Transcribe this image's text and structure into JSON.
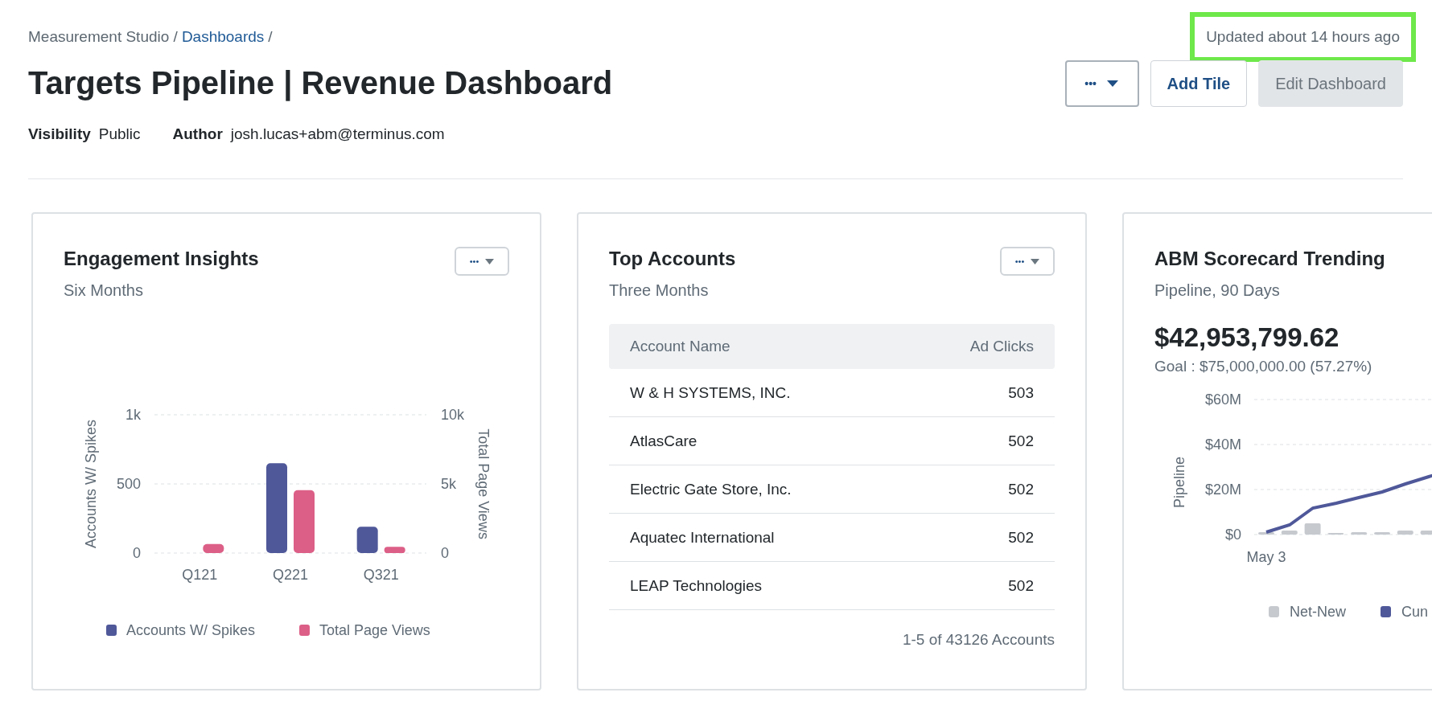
{
  "breadcrumb": {
    "root": "Measurement Studio",
    "separator": "/",
    "link": "Dashboards"
  },
  "updated": {
    "text": "Updated about 14 hours ago",
    "highlighted": true
  },
  "title": "Targets Pipeline | Revenue Dashboard",
  "actions": {
    "menu": "•••",
    "add": "Add Tile",
    "edit": "Edit Dashboard",
    "edit_disabled": true
  },
  "meta": [
    {
      "label": "Visibility",
      "value": "Public"
    },
    {
      "label": "Author",
      "value": "josh.lucas+abm@terminus.com"
    }
  ],
  "tiles": [
    {
      "kind": "bar",
      "title": "Engagement Insights",
      "subtitle": "Six Months",
      "menu": "•••",
      "chart_data": {
        "type": "bar",
        "stacked": false,
        "legend": true,
        "ylabel": "Accounts W/ Spikes",
        "y2label": "Total Page Views",
        "categories": [
          "Q121",
          "Q221",
          "Q321"
        ],
        "ylim": [
          0,
          1000
        ],
        "y2lim": [
          0,
          10000
        ],
        "yticks": [
          {
            "value": 0,
            "label": "0"
          },
          {
            "value": 500,
            "label": "500"
          },
          {
            "value": 1000,
            "label": "1k"
          }
        ],
        "y2ticks": [
          {
            "value": 0,
            "label": "0"
          },
          {
            "value": 5000,
            "label": "5k"
          },
          {
            "value": 10000,
            "label": "10k"
          }
        ],
        "series": [
          {
            "name": "Accounts W/ Spikes",
            "color": "#4f5899",
            "values": [
              0,
              650,
              190
            ]
          },
          {
            "name": "Total Page Views",
            "color": "#dc5f87",
            "axis": "y2",
            "values": [
              650,
              4550,
              450
            ]
          }
        ]
      }
    },
    {
      "kind": "table",
      "title": "Top Accounts",
      "subtitle": "Three Months",
      "menu": "•••",
      "columns": [
        "Account Name",
        "Ad Clicks"
      ],
      "rows": [
        [
          "W & H SYSTEMS, INC.",
          "503"
        ],
        [
          "AtlasCare",
          "502"
        ],
        [
          "Electric Gate Store, Inc.",
          "502"
        ],
        [
          "Aquatec International",
          "502"
        ],
        [
          "LEAP Technologies",
          "502"
        ]
      ],
      "footer": "1-5 of 43126 Accounts"
    },
    {
      "kind": "line",
      "title": "ABM Scorecard Trending",
      "subtitle": "Pipeline, 90 Days",
      "value": "$42,953,799.62",
      "goal": "Goal : $75,000,000.00 (57.27%)",
      "first_date": "May 3",
      "axis_title": "Pipeline",
      "y_ticks": [
        "$60M",
        "$40M",
        "$20M",
        "$0"
      ],
      "legend": [
        {
          "name": "Net-New",
          "color": "#c6cacf"
        },
        {
          "name": "Cun",
          "color": "#4f5899"
        }
      ]
    }
  ]
}
